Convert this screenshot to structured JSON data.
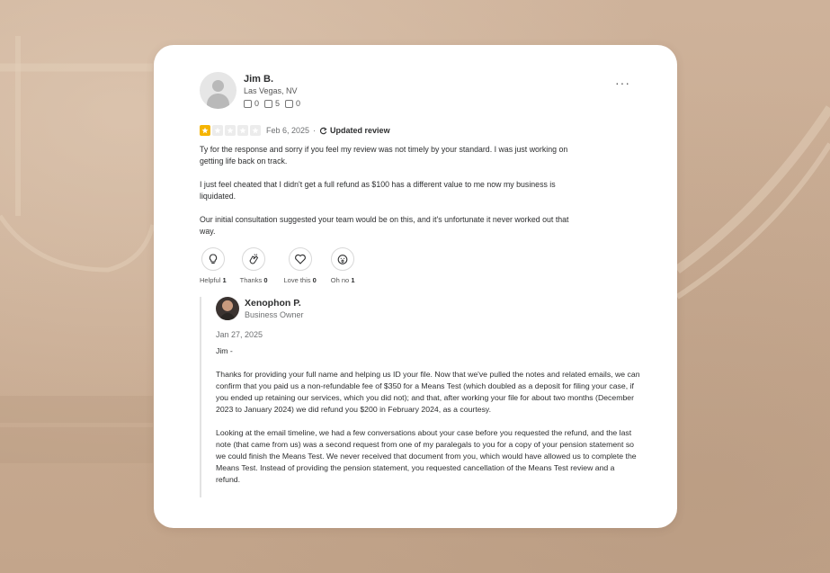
{
  "review": {
    "author": {
      "name": "Jim B.",
      "location": "Las Vegas, NV",
      "friends_count": "0",
      "reviews_count": "5",
      "photos_count": "0"
    },
    "rating": 1,
    "rating_max": 5,
    "date": "Feb 6, 2025",
    "separator": "·",
    "updated_label": "Updated review",
    "paragraphs": [
      "Ty for the response and sorry if you feel my review was not timely by your standard. I was just working on getting life back on track.",
      "I just feel cheated that I didn't get a full refund as $100 has a different value to me now my business is liquidated.",
      "Our initial consultation suggested your team would be on this, and it's unfortunate it never worked out that way."
    ],
    "more_label": "···",
    "reactions": [
      {
        "label": "Helpful",
        "count": "1",
        "icon": "lightbulb-icon"
      },
      {
        "label": "Thanks",
        "count": "0",
        "icon": "clapping-hands-icon"
      },
      {
        "label": "Love this",
        "count": "0",
        "icon": "heart-icon"
      },
      {
        "label": "Oh no",
        "count": "1",
        "icon": "shocked-face-icon"
      }
    ]
  },
  "reply": {
    "owner_name": "Xenophon P.",
    "owner_role": "Business Owner",
    "date": "Jan 27, 2025",
    "paragraphs": [
      "Jim -",
      "Thanks for providing your full name and helping us ID your file. Now that we've pulled the notes and related emails, we can confirm that you paid us a non-refundable fee of $350 for a Means Test (which doubled as a deposit for filing your case, if you ended up retaining our services, which you did not); and that, after working your file for about two months (December 2023 to January 2024) we did refund you $200 in February 2024, as a courtesy.",
      "Looking at the email timeline, we had a few conversations about your case before you requested the refund, and the last note (that came from us) was a second request from one of my paralegals to you for a copy of your pension statement so we could finish the Means Test. We never received that document from you, which would have allowed us to complete the Means Test. Instead of providing the pension statement, you requested cancellation of the Means Test review and a refund."
    ]
  },
  "colors": {
    "star_on": "#f5b400",
    "star_off": "#ececec",
    "background": "#c8ab92"
  }
}
